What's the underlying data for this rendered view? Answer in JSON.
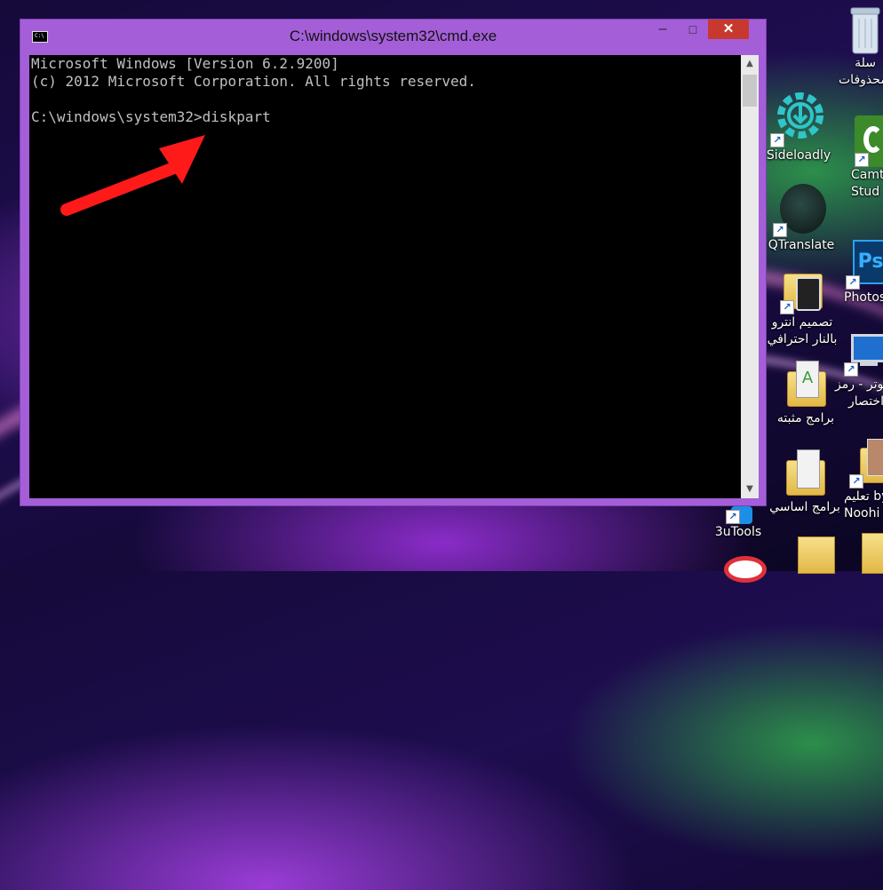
{
  "window": {
    "title": "C:\\windows\\system32\\cmd.exe",
    "icon_text": "C:\\",
    "controls": {
      "minimize": "‒",
      "maximize": "□",
      "close": "✕"
    },
    "console_lines": [
      "Microsoft Windows [Version 6.2.9200]",
      "(c) 2012 Microsoft Corporation. All rights reserved.",
      "",
      "C:\\windows\\system32>diskpart"
    ],
    "scroll_up": "▲",
    "scroll_down": "▼"
  },
  "annotation": {
    "color": "#ff1a1a"
  },
  "desktop_icons": {
    "recycle_bin": {
      "line1": "سلة",
      "line2": "المحذوفات"
    },
    "sideloadly": {
      "label": "Sideloadly"
    },
    "camtasia": {
      "line1": "Camt",
      "line2": "Stud"
    },
    "qtranslate": {
      "label": "QTranslate"
    },
    "photoshop": {
      "label": "Photos"
    },
    "intro_design": {
      "line1": "تصميم انترو",
      "line2": "بالنار احترافي"
    },
    "computer": {
      "line1": "كمبيوتر - رمز",
      "line2": "اختصار"
    },
    "installed_programs": {
      "label": "برامج مثبته"
    },
    "basic_programs": {
      "label": "برامج اساسي"
    },
    "noohi": {
      "line1": "تعليم by",
      "line2": "Noohi"
    },
    "threeutools": {
      "label": "3uTools"
    }
  },
  "colors": {
    "window_frame": "#a45fd8",
    "close_button": "#c7392e",
    "console_bg": "#000000",
    "console_text": "#c0c0c0"
  }
}
